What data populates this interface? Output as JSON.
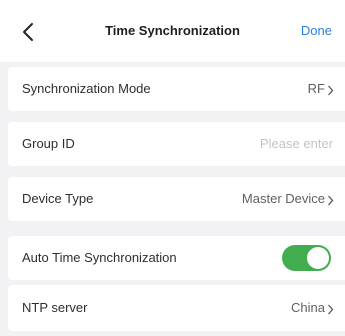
{
  "nav": {
    "title": "Time Synchronization",
    "done_label": "Done"
  },
  "rows": {
    "sync_mode": {
      "label": "Synchronization Mode",
      "value": "RF"
    },
    "group_id": {
      "label": "Group ID",
      "placeholder": "Please enter",
      "value": ""
    },
    "device_type": {
      "label": "Device Type",
      "value": "Master Device"
    },
    "auto_sync": {
      "label": "Auto Time Synchronization",
      "enabled": true
    },
    "ntp_server": {
      "label": "NTP server",
      "value": "China"
    }
  },
  "colors": {
    "accent": "#2d7fe2",
    "toggle_on": "#41ad4e",
    "background": "#f2f2f5"
  }
}
